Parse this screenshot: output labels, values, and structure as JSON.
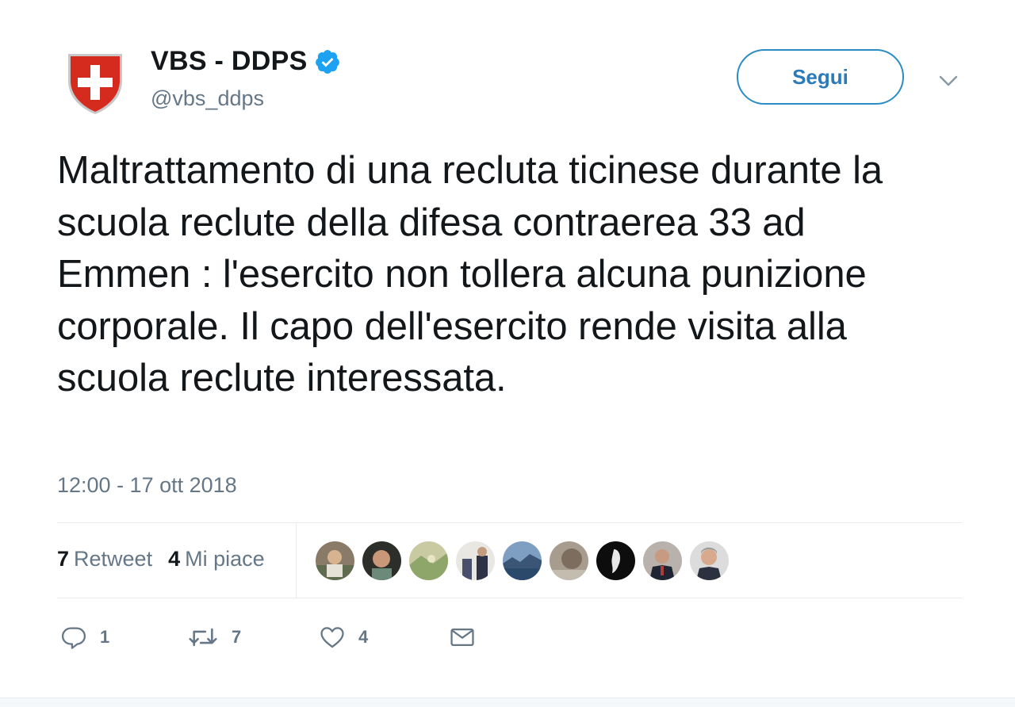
{
  "account": {
    "display_name": "VBS - DDPS",
    "handle": "@vbs_ddps",
    "verified_icon": "verified-badge-icon",
    "avatar_icon": "swiss-shield-icon"
  },
  "follow_label": "Segui",
  "tweet": {
    "text": "Maltrattamento di una recluta ticinese durante la scuola reclute della difesa contraerea 33 ad Emmen : l'esercito non tollera alcuna punizione corporale. Il capo dell'esercito rende visita alla scuola reclute interessata.",
    "timestamp": "12:00 - 17 ott 2018"
  },
  "stats": {
    "retweets_count": "7",
    "retweets_label": "Retweet",
    "likes_count": "4",
    "likes_label": "Mi piace"
  },
  "likers": [
    {
      "icon": "user-avatar-1"
    },
    {
      "icon": "user-avatar-2"
    },
    {
      "icon": "user-avatar-3"
    },
    {
      "icon": "user-avatar-4"
    },
    {
      "icon": "user-avatar-5"
    },
    {
      "icon": "user-avatar-6"
    },
    {
      "icon": "user-avatar-7"
    },
    {
      "icon": "user-avatar-8"
    },
    {
      "icon": "user-avatar-9"
    }
  ],
  "actions": {
    "reply_count": "1",
    "retweet_count": "7",
    "like_count": "4"
  },
  "colors": {
    "accent": "#1da1f2",
    "text": "#14171a",
    "muted": "#657786",
    "shield_red": "#d52b1e"
  }
}
